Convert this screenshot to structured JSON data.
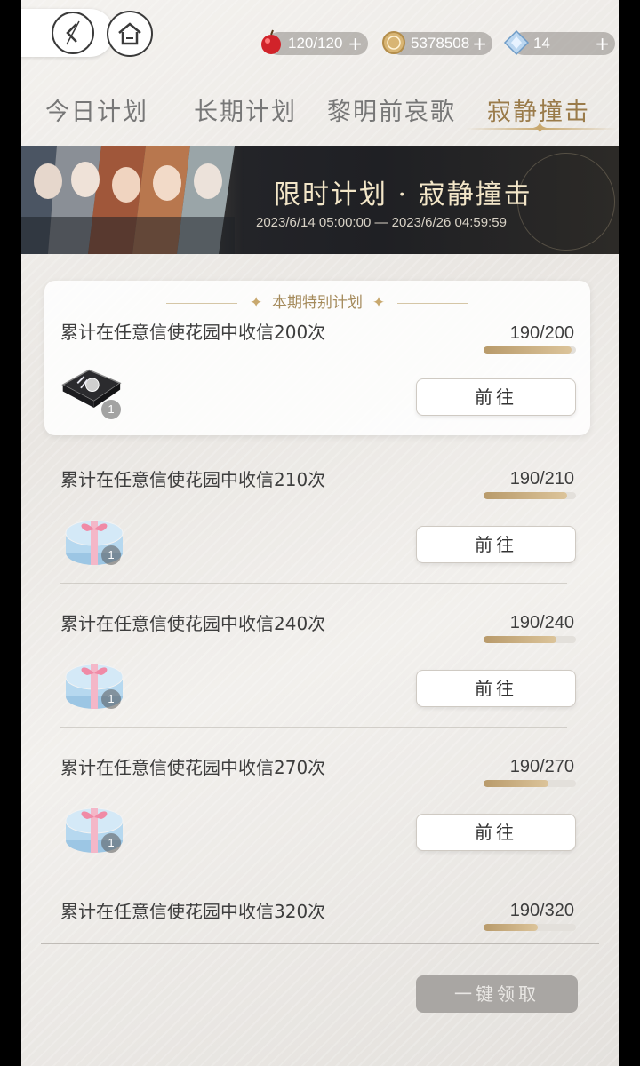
{
  "resources": [
    {
      "icon": "apple-icon",
      "value": "120/120",
      "plus": "+"
    },
    {
      "icon": "coin-icon",
      "value": "5378508",
      "plus": "+"
    },
    {
      "icon": "diamond-icon",
      "value": "14",
      "plus": "+"
    }
  ],
  "tabs": [
    {
      "label": "今日计划",
      "active": false
    },
    {
      "label": "长期计划",
      "active": false
    },
    {
      "label": "黎明前哀歌",
      "active": false
    },
    {
      "label": "寂静撞击",
      "active": true
    }
  ],
  "banner": {
    "title": "限时计划 · 寂静撞击",
    "date_range": "2023/6/14 05:00:00 — 2023/6/26 04:59:59"
  },
  "special_header": "本期特别计划",
  "tasks": [
    {
      "title": "累计在任意信使花园中收信200次",
      "count": "190/200",
      "progress": 0.95,
      "button": "前往",
      "reward": "dark-box-icon",
      "qty": "1"
    },
    {
      "title": "累计在任意信使花园中收信210次",
      "count": "190/210",
      "progress": 0.905,
      "button": "前往",
      "reward": "gift-box-icon",
      "qty": "1"
    },
    {
      "title": "累计在任意信使花园中收信240次",
      "count": "190/240",
      "progress": 0.79,
      "button": "前往",
      "reward": "gift-box-icon",
      "qty": "1"
    },
    {
      "title": "累计在任意信使花园中收信270次",
      "count": "190/270",
      "progress": 0.7,
      "button": "前往",
      "reward": "gift-box-icon",
      "qty": "1"
    },
    {
      "title": "累计在任意信使花园中收信320次",
      "count": "190/320",
      "progress": 0.59,
      "button": "",
      "reward": "gift-box-icon",
      "qty": ""
    }
  ],
  "claim_all": "一键领取",
  "colors": {
    "accent": "#9a7b4a",
    "bar_fill": "#c9ad7e",
    "banner_bg": "#222327"
  }
}
